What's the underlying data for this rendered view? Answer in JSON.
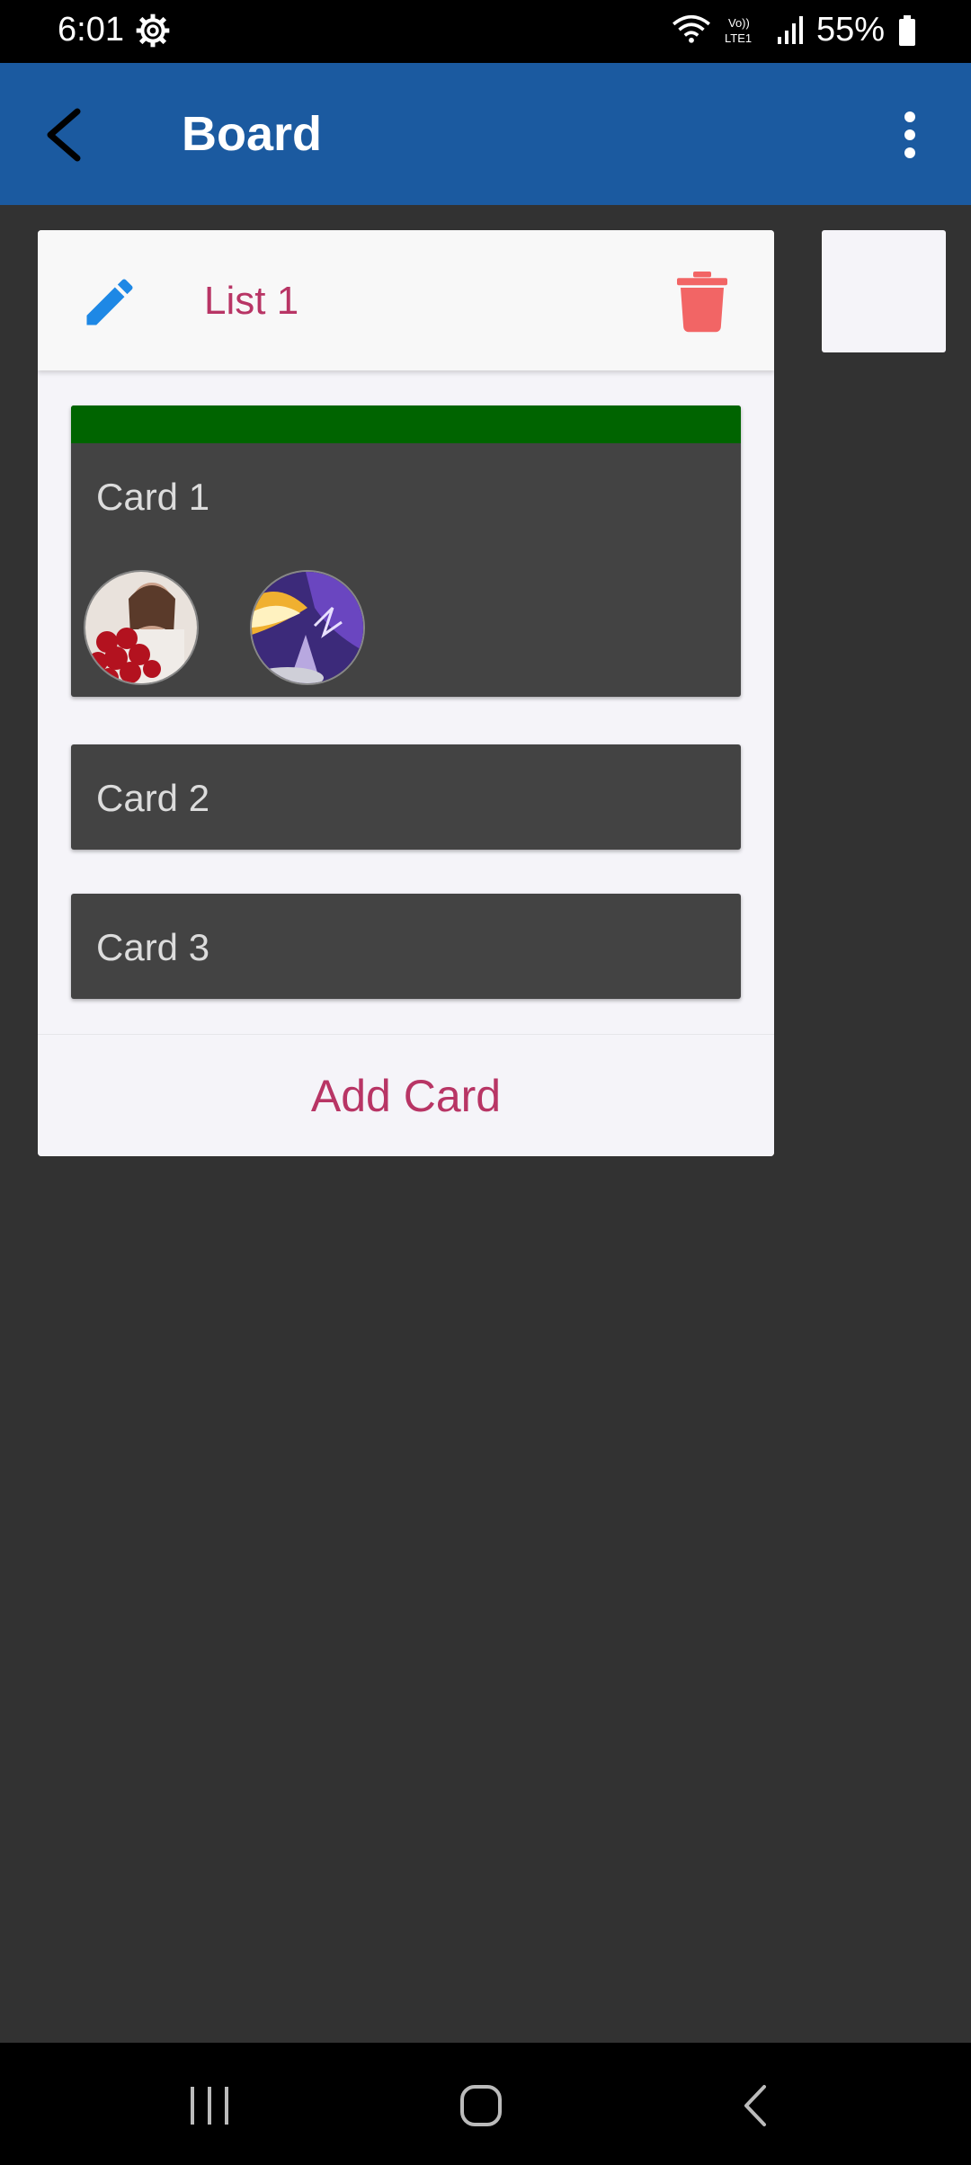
{
  "status_bar": {
    "time": "6:01",
    "battery": "55%",
    "icons": [
      "settings-gear-icon",
      "wifi-icon",
      "volte-icon",
      "signal-icon",
      "battery-icon"
    ]
  },
  "app_bar": {
    "title": "Board",
    "icons": [
      "back-arrow-icon",
      "more-vert-icon"
    ],
    "color": "#1b5aa0"
  },
  "list": {
    "title": "List 1",
    "icons": [
      "pencil-icon",
      "trash-icon"
    ],
    "cards": [
      {
        "title": "Card 1",
        "label_color": "#006400",
        "members": [
          "avatar-roses",
          "avatar-purple-art"
        ]
      },
      {
        "title": "Card 2"
      },
      {
        "title": "Card 3"
      }
    ],
    "add_card_label": "Add Card"
  },
  "nav_bar": {
    "icons": [
      "recents-icon",
      "home-icon",
      "back-icon"
    ]
  },
  "colors": {
    "accent": "#b83565",
    "background": "#323232",
    "card": "#434343",
    "delete": "#f26565",
    "edit": "#1e88e5"
  }
}
